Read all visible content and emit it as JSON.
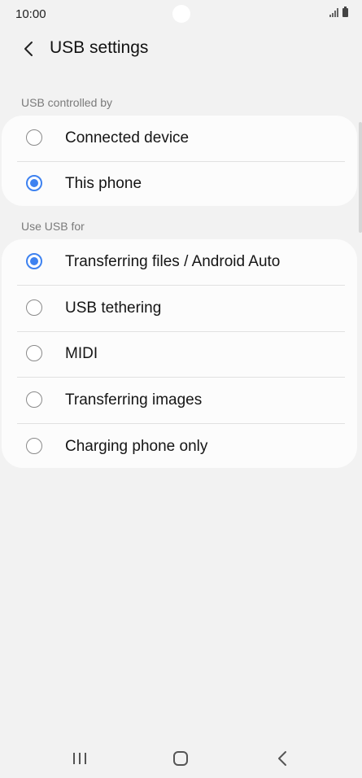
{
  "status_bar": {
    "time": "10:00"
  },
  "header": {
    "title": "USB settings"
  },
  "sections": [
    {
      "label": "USB controlled by",
      "options": [
        {
          "label": "Connected device",
          "selected": false
        },
        {
          "label": "This phone",
          "selected": true
        }
      ]
    },
    {
      "label": "Use USB for",
      "options": [
        {
          "label": "Transferring files / Android Auto",
          "selected": true
        },
        {
          "label": "USB tethering",
          "selected": false
        },
        {
          "label": "MIDI",
          "selected": false
        },
        {
          "label": "Transferring images",
          "selected": false
        },
        {
          "label": "Charging phone only",
          "selected": false
        }
      ]
    }
  ],
  "colors": {
    "accent": "#3e82f0",
    "background": "#f2f2f2",
    "card": "#fcfcfc"
  },
  "icons": [
    "back-arrow-icon",
    "signal-icon",
    "battery-icon",
    "recents-icon",
    "home-icon",
    "nav-back-icon"
  ]
}
